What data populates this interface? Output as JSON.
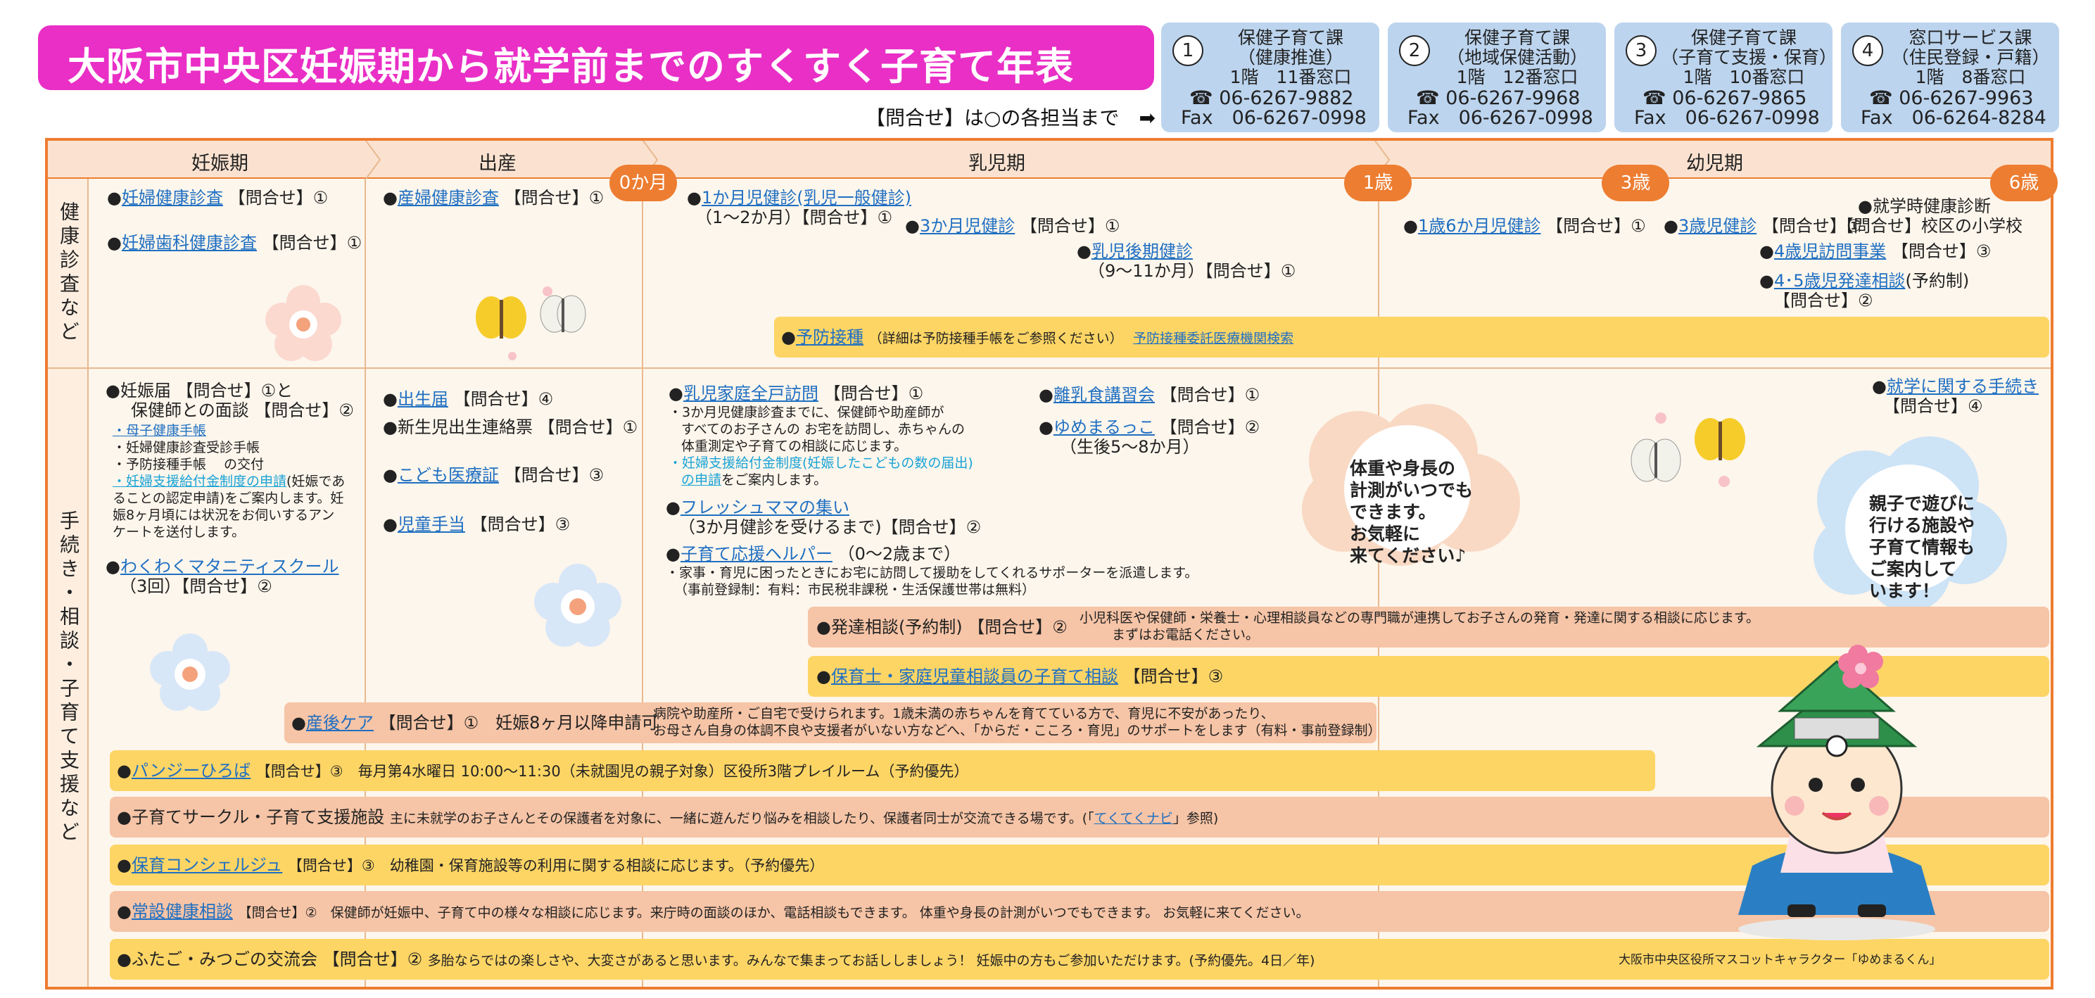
{
  "header": {
    "title": "大阪市中央区妊娠期から就学前までのすくすく子育て年表",
    "inquiry_note": "【問合せ】は○の各担当まで",
    "arrow": "➡"
  },
  "contacts": [
    {
      "num": "1",
      "line1": "保健子育て課",
      "line2": "（健康推進）",
      "line3": "1階　11番窓口",
      "tel": "☎ 06-6267-9882",
      "fax": "Fax　06-6267-0998"
    },
    {
      "num": "2",
      "line1": "保健子育て課",
      "line2": "（地域保健活動）",
      "line3": "1階　12番窓口",
      "tel": "☎ 06-6267-9968",
      "fax": "Fax　06-6267-0998"
    },
    {
      "num": "3",
      "line1": "保健子育て課",
      "line2": "（子育て支援・保育）",
      "line3": "1階　10番窓口",
      "tel": "☎ 06-6267-9865",
      "fax": "Fax　06-6267-0998"
    },
    {
      "num": "4",
      "line1": "窓口サービス課",
      "line2": "（住民登録・戸籍）",
      "line3": "1階　8番窓口",
      "tel": "☎ 06-6267-9963",
      "fax": "Fax　06-6264-8284"
    }
  ],
  "periods": [
    "妊娠期",
    "出産",
    "乳児期",
    "幼児期"
  ],
  "ages": [
    "0か月",
    "1歳",
    "3歳",
    "6歳"
  ],
  "rows": [
    "健康診査など",
    "手続き・相談・子育て支援など"
  ],
  "health": {
    "ninshin1": "妊婦健康診査",
    "ninshin1_q": "【問合せ】①",
    "ninshin2": "妊婦歯科健康診査",
    "ninshin2_q": "【問合せ】①",
    "sanpu": "産婦健康診査",
    "sanpu_q": "【問合せ】①",
    "m1": "1か月児健診(乳児一般健診)",
    "m1_sub": "（1～2か月）【問合せ】①",
    "m3": "3か月児健診",
    "m3_q": "【問合せ】①",
    "late": "乳児後期健診",
    "late_sub": "（9～11か月）【問合せ】①",
    "m18": "1歳6か月児健診",
    "m18_q": "【問合せ】①",
    "y3": "3歳児健診",
    "y3_q": "【問合せ】①",
    "school": "就学時健康診断",
    "school_q": "【問合せ】校区の小学校",
    "y4": "4歳児訪問事業",
    "y4_q": "【問合せ】③",
    "y45": "4･5歳児発達相談",
    "y45_q": "(予約制)",
    "y45_q2": "【問合せ】②",
    "vaccine": "予防接種",
    "vaccine_note": "（詳細は予防接種手帳をご参照ください）",
    "vaccine_link": "予防接種委託医療機関検索"
  },
  "proc": {
    "todoke": "●妊娠届 【問合せ】①と",
    "todoke2": "保健師との面談 【問合せ】②",
    "boshi": "・母子健康手帳",
    "jushin": "・妊婦健康診査受診手帳",
    "yobo": "・予防接種手帳　 の交付",
    "shien": "・妊婦支援給付金制度の申請",
    "shien2": "(妊娠であ",
    "shien3": "ることの認定申請)をご案内します。妊",
    "shien4": "娠8ヶ月頃には状況をお伺いするアン",
    "shien5": "ケートを送付します。",
    "waku": "わくわくマタニティスクール",
    "waku_sub": "（3回）【問合せ】②",
    "shusseitodoke": "出生届",
    "shusseitodoke_q": "【問合せ】④",
    "renraku": "●新生児出生連絡票 【問合せ】①",
    "iryo": "こども医療証",
    "iryo_q": "【問合せ】③",
    "teate": "児童手当",
    "teate_q": "【問合せ】③",
    "homon": "乳児家庭全戸訪問",
    "homon_q": "【問合せ】①",
    "homon1": "・3か月児健康診査までに、保健師や助産師が",
    "homon2": "すべてのお子さんの お宅を訪問し、赤ちゃんの",
    "homon3": "体重測定や子育ての相談に応じます。",
    "homon4": "・妊婦支援給付金制度(妊娠したこどもの数の届出)",
    "homon5": "の申請",
    "homon6": "をご案内します。",
    "fresh": "フレッシュママの集い",
    "fresh_sub": "（3か月健診を受けるまで)【問合せ】②",
    "helper": "子育て応援ヘルパー",
    "helper_age": "（0～2歳まで）",
    "helper1": "・家事・育児に困ったときにお宅に訪問して援助をしてくれるサポーターを派遣します。",
    "helper2": "（事前登録制：有料：市民税非課税・生活保護世帯は無料）",
    "rinyu": "離乳食講習会",
    "rinyu_q": "【問合せ】①",
    "yume": "ゆめまるっこ",
    "yume_q": "【問合せ】②",
    "yume_sub": "（生後5～8か月）",
    "shugaku": "就学に関する手続き",
    "shugaku_q": "【問合せ】④"
  },
  "bars": {
    "hattatsu": "●発達相談(予約制) 【問合せ】②",
    "hattatsu_note1": "小児科医や保健師・栄養士・心理相談員などの専門職が連携してお子さんの発育・発達に関する相談に応じます。",
    "hattatsu_note2": "まずはお電話ください。",
    "hoiku": "保育士・家庭児童相談員の子育て相談",
    "hoiku_q": "【問合せ】③",
    "sango": "産後ケア",
    "sango_q": "【問合せ】①　妊娠8ヶ月以降申請可",
    "sango_note1": "病院や助産所・ご自宅で受けられます。1歳未満の赤ちゃんを育てている方で、育児に不安があったり、",
    "sango_note2": "お母さん自身の体調不良や支援者がいない方などへ、「からだ・こころ・育児」のサポートをします（有料・事前登録制）",
    "pansy": "パンジーひろば",
    "pansy_q": "【問合せ】③　毎月第4水曜日 10:00～11:30（未就園児の親子対象）区役所3階プレイルーム（予約優先）",
    "circle": "●子育てサークル・子育て支援施設",
    "circle_note": "主に未就学のお子さんとその保護者を対象に、一緒に遊んだり悩みを相談したり、保護者同士が交流できる場です。(「",
    "circle_link": "てくてくナビ",
    "circle_end": "」参照)",
    "concierge": "保育コンシェルジュ",
    "concierge_q": "【問合せ】③　幼稚園・保育施設等の利用に関する相談に応じます。（予約優先）",
    "jousetsu": "常設健康相談",
    "jousetsu_q": "【問合せ】②　保健師が妊娠中、子育て中の様々な相談に応じます。来庁時の面談のほか、電話相談もできます。 体重や身長の計測がいつでもできます。 お気軽に来てください。",
    "futago": "●ふたご・みつごの交流会 【問合せ】②",
    "futago_note": "多胎ならではの楽しさや、大変さがあると思います。みんなで集まってお話ししましょう！ 妊娠中の方もご参加いただけます。(予約優先。4日／年)"
  },
  "bubbles": {
    "b1": [
      "体重や身長の",
      "計測がいつでも",
      "できます。",
      "お気軽に",
      "来てください♪"
    ],
    "b2": [
      "親子で遊びに",
      "行ける施設や",
      "子育て情報も",
      "ご案内して",
      "います！"
    ]
  },
  "mascot_caption": "大阪市中央区役所マスコットキャラクター「ゆめまるくん」",
  "colors": {
    "title_bg": "#e92fc6",
    "accent": "#ed7d31",
    "contact_bg": "#bcd4ee",
    "yellow_bar": "#fdd565",
    "peach_bar": "#f6c4a6",
    "link": "#1f6fc2"
  }
}
